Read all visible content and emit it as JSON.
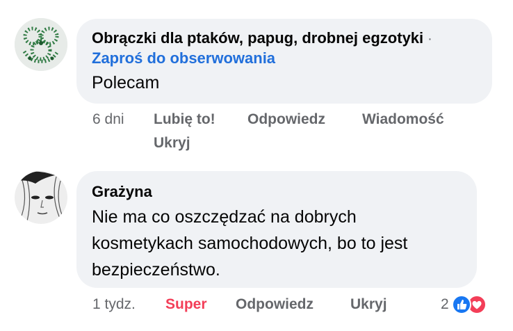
{
  "comments": [
    {
      "author": "Obrączki dla ptaków, papug, drobnej egzotyki",
      "separator": "·",
      "follow_label": "Zaproś do obserwowania",
      "text": "Polecam",
      "actions": {
        "time": "6 dni",
        "like": "Lubię to!",
        "reply": "Odpowiedz",
        "message": "Wiadomość",
        "hide": "Ukryj"
      },
      "avatar_icon": "green-bead-logo"
    },
    {
      "author": "Grażyna",
      "text_lines": [
        "Nie ma co oszczędzać na dobrych",
        "kosmetykach samochodowych, bo to jest",
        "bezpieczeństwo."
      ],
      "actions": {
        "time": "1 tydz.",
        "reaction": "Super",
        "reply": "Odpowiedz",
        "hide": "Ukryj"
      },
      "reactions": {
        "count": "2",
        "icons": [
          "like-reaction-icon",
          "love-reaction-icon"
        ]
      },
      "avatar_icon": "sketch-portrait"
    }
  ],
  "colors": {
    "bubble": "#f0f2f5",
    "link": "#216fdb",
    "secondary_text": "#65676b",
    "super": "#f33e58",
    "like": "#1877f2",
    "love": "#f33e58"
  }
}
